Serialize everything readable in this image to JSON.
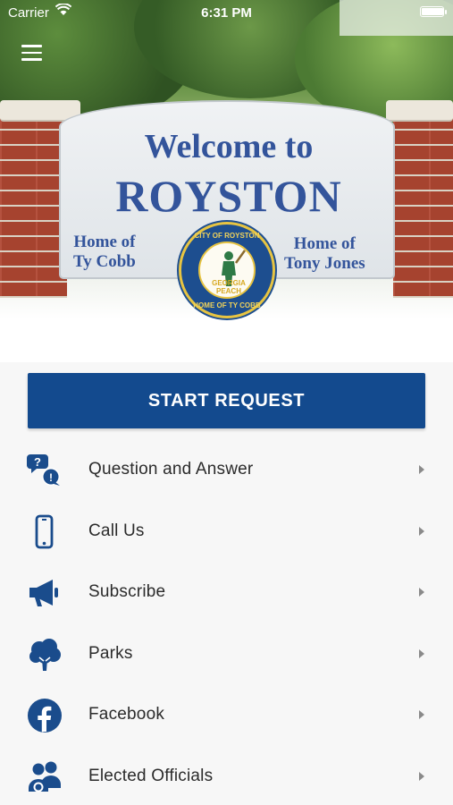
{
  "status_bar": {
    "carrier": "Carrier",
    "time": "6:31 PM",
    "battery_level": 0.95
  },
  "hero": {
    "sign_line1": "Welcome to",
    "sign_line2": "ROYSTON",
    "home_left_1": "Home of",
    "home_left_2": "Ty Cobb",
    "home_right_1": "Home of",
    "home_right_2": "Tony Jones",
    "seal_top": "CITY OF ROYSTON",
    "seal_center_1": "GEORGIA",
    "seal_center_2": "PEACH",
    "seal_bottom": "HOME OF TY COBB"
  },
  "start_button": {
    "label": "START REQUEST"
  },
  "menu": [
    {
      "label": "Question and Answer",
      "icon": "question-bubbles-icon"
    },
    {
      "label": "Call Us",
      "icon": "phone-icon"
    },
    {
      "label": "Subscribe",
      "icon": "megaphone-icon"
    },
    {
      "label": "Parks",
      "icon": "tree-icon"
    },
    {
      "label": "Facebook",
      "icon": "facebook-icon"
    },
    {
      "label": "Elected Officials",
      "icon": "people-icon"
    }
  ],
  "colors": {
    "primary": "#134a8e",
    "icon": "#1a4c8c",
    "chevron": "#8a8a8a"
  }
}
